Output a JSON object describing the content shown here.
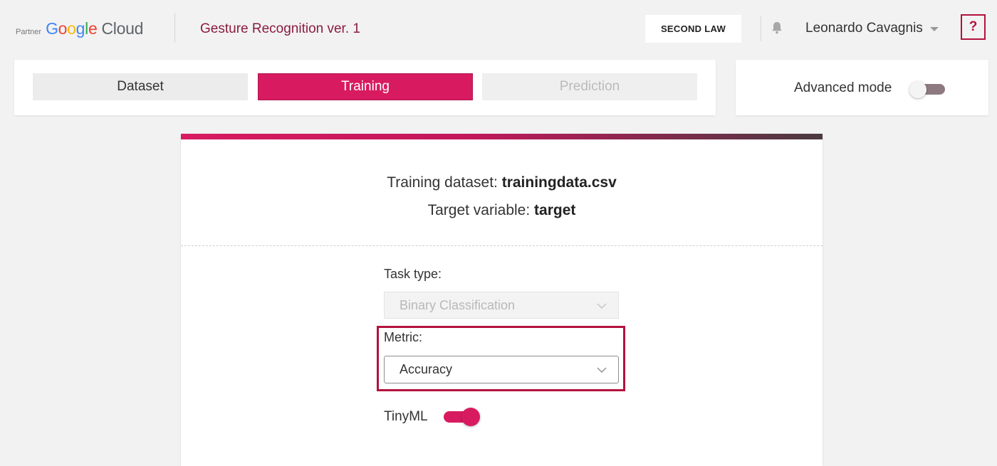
{
  "header": {
    "partner_label": "Partner",
    "logo": {
      "g1": "G",
      "g2": "o",
      "g3": "o",
      "g4": "g",
      "g5": "l",
      "g6": "e",
      "cloud": "Cloud"
    },
    "project_title": "Gesture Recognition ver. 1",
    "org_button_label": "SECOND LAW",
    "user_name": "Leonardo Cavagnis",
    "help_label": "?",
    "icons": {
      "bell": "bell-icon",
      "user_menu": "chevron-down-icon"
    }
  },
  "tabs": [
    {
      "label": "Dataset",
      "state": "default"
    },
    {
      "label": "Training",
      "state": "active"
    },
    {
      "label": "Prediction",
      "state": "disabled"
    }
  ],
  "advanced_mode": {
    "label": "Advanced mode",
    "enabled": false
  },
  "dataset_info": {
    "dataset_prefix": "Training dataset: ",
    "dataset_name": "trainingdata.csv",
    "target_prefix": "Target variable: ",
    "target_name": "target"
  },
  "form": {
    "task_type_label": "Task type:",
    "task_type_value": "Binary Classification",
    "task_type_disabled": true,
    "metric_label": "Metric:",
    "metric_value": "Accuracy",
    "tinyml_label": "TinyML",
    "tinyml_enabled": true
  },
  "colors": {
    "accent": "#d81b60",
    "accent_dark": "#b3123d",
    "title": "#8a1c3f",
    "background": "#f2f2f2"
  }
}
